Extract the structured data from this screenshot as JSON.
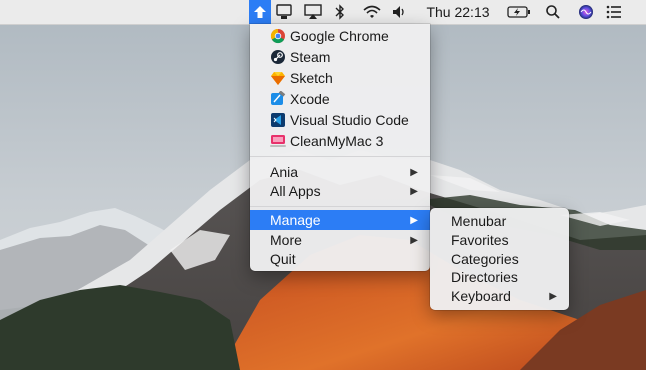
{
  "menubar": {
    "clock": "Thu 22:13",
    "icons": [
      "launcher-icon",
      "display-icon",
      "airplay-icon",
      "bluetooth-icon",
      "wifi-icon",
      "volume-icon",
      "battery-icon",
      "spotlight-icon",
      "siri-icon",
      "notification-center-icon"
    ]
  },
  "main_menu": {
    "apps": [
      {
        "label": "Google Chrome",
        "icon": "chrome-icon"
      },
      {
        "label": "Steam",
        "icon": "steam-icon"
      },
      {
        "label": "Sketch",
        "icon": "sketch-icon"
      },
      {
        "label": "Xcode",
        "icon": "xcode-icon"
      },
      {
        "label": "Visual Studio Code",
        "icon": "vscode-icon"
      },
      {
        "label": "CleanMyMac 3",
        "icon": "cleanmymac-icon"
      }
    ],
    "groups": [
      {
        "label": "Ania",
        "submenu": true
      },
      {
        "label": "All Apps",
        "submenu": true
      }
    ],
    "actions": [
      {
        "label": "Manage",
        "submenu": true,
        "highlighted": true
      },
      {
        "label": "More",
        "submenu": true
      },
      {
        "label": "Quit",
        "submenu": false
      }
    ]
  },
  "manage_submenu": {
    "items": [
      {
        "label": "Menubar",
        "submenu": false
      },
      {
        "label": "Favorites",
        "submenu": false
      },
      {
        "label": "Categories",
        "submenu": false
      },
      {
        "label": "Directories",
        "submenu": false
      },
      {
        "label": "Keyboard",
        "submenu": true
      }
    ]
  },
  "colors": {
    "highlight": "#2c7df5",
    "menu_bg": "#eeeef0",
    "sky": "#b9c2c9"
  }
}
